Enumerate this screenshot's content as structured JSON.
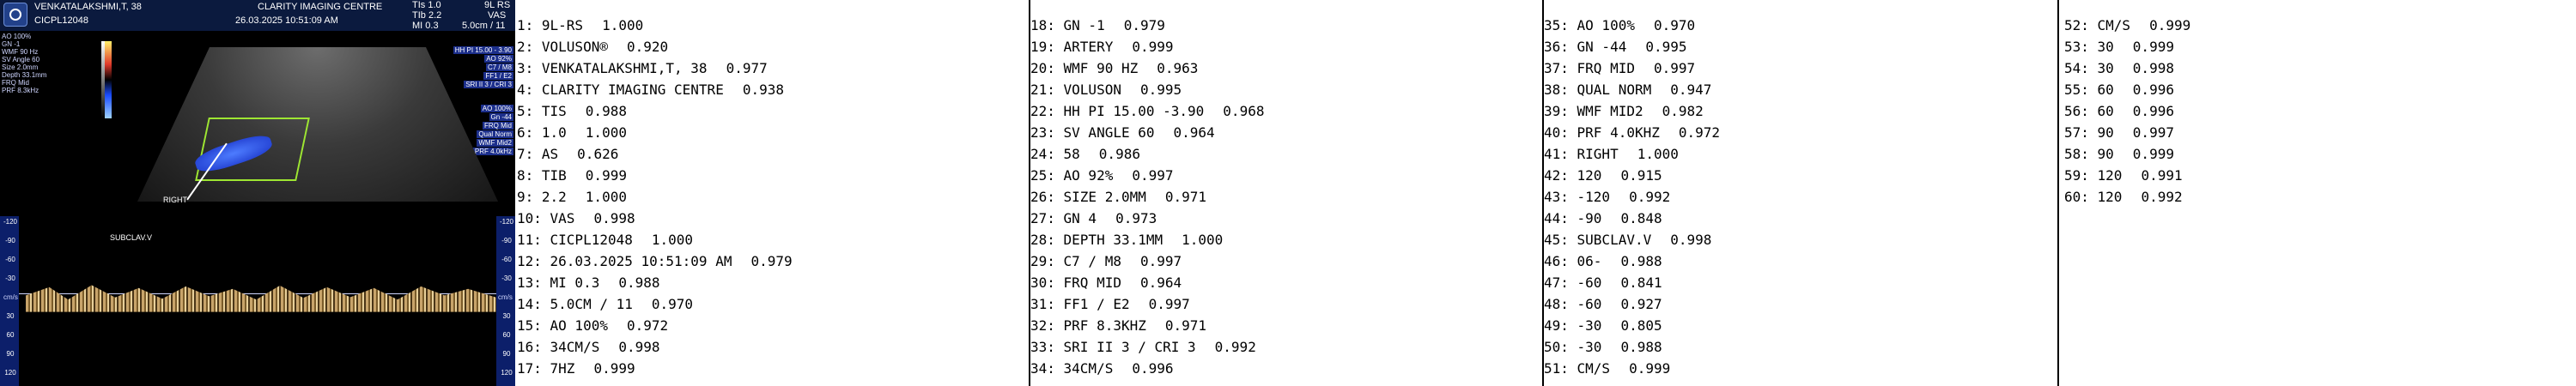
{
  "screenshot": {
    "header": {
      "patient_name": "VENKATALAKSHMI,T,  38",
      "centre": "CLARITY IMAGING CENTRE",
      "patient_id": "CICPL12048",
      "datetime": "26.03.2025  10:51:09 AM",
      "ti": "TIs   1.0",
      "tib": "TIb   2.2",
      "mi": "MI  0.3",
      "depth_field": "5.0cm / 11",
      "probe": "9L RS",
      "preset": "VAS"
    },
    "left_params": [
      "AO 100%",
      "GN -1",
      "WMF 90 Hz",
      "SV Angle 60",
      "Size 2.0mm",
      "Depth 33.1mm",
      "FRQ Mid",
      "PRF 8.3kHz"
    ],
    "right_params": [
      "HH PI 15.00 - 3.90",
      "AO 92%",
      "C7 / M8",
      "FF1 / E2",
      "SRI II 3 / CRI 3"
    ],
    "right_params2": [
      "AO 100%",
      "Gn -44",
      "FRQ Mid",
      "Qual Norm",
      "WMF Mid2",
      "PRF 4.0kHz"
    ],
    "image_labels": {
      "side": "RIGHT",
      "vessel": "SUBCLAV.V",
      "velocity_unit": "cm/s"
    },
    "scale_left": [
      "-120",
      "-90",
      "-60",
      "-30",
      "",
      "30",
      "60",
      "90",
      "120"
    ],
    "scale_right": [
      "-120",
      "-90",
      "-60",
      "-30",
      "",
      "30",
      "60",
      "90",
      "120"
    ]
  },
  "ocr_columns": [
    {
      "lines": [
        {
          "text": "1: 9L-RS",
          "score": "1.000"
        },
        {
          "text": "2: VOLUSON®",
          "score": "0.920"
        },
        {
          "text": "3: VENKATALAKSHMI,T, 38",
          "score": "0.977"
        },
        {
          "text": "4: CLARITY IMAGING CENTRE",
          "score": "0.938"
        },
        {
          "text": "5: TIS",
          "score": "0.988"
        },
        {
          "text": "6: 1.0",
          "score": "1.000"
        },
        {
          "text": "7: AS",
          "score": "0.626"
        },
        {
          "text": "8: TIB",
          "score": "0.999"
        },
        {
          "text": "9: 2.2",
          "score": "1.000"
        },
        {
          "text": "10: VAS",
          "score": "0.998"
        },
        {
          "text": "11: CICPL12048",
          "score": "1.000"
        },
        {
          "text": "12: 26.03.2025 10:51:09 AM",
          "score": "0.979"
        },
        {
          "text": "13: MI 0.3",
          "score": "0.988"
        },
        {
          "text": "14: 5.0CM / 11",
          "score": "0.970"
        },
        {
          "text": "15: AO 100%",
          "score": "0.972"
        },
        {
          "text": "16: 34CM/S",
          "score": "0.998"
        },
        {
          "text": "17: 7HZ",
          "score": "0.999"
        }
      ]
    },
    {
      "lines": [
        {
          "text": "18: GN -1",
          "score": "0.979"
        },
        {
          "text": "19: ARTERY",
          "score": "0.999"
        },
        {
          "text": "20: WMF 90 HZ",
          "score": "0.963"
        },
        {
          "text": "21: VOLUSON",
          "score": "0.995"
        },
        {
          "text": "22: HH PI 15.00 -3.90",
          "score": "0.968"
        },
        {
          "text": "23: SV ANGLE 60",
          "score": "0.964"
        },
        {
          "text": "24: 58",
          "score": "0.986"
        },
        {
          "text": "25: AO 92%",
          "score": "0.997"
        },
        {
          "text": "26: SIZE 2.0MM",
          "score": "0.971"
        },
        {
          "text": "27: GN 4",
          "score": "0.973"
        },
        {
          "text": "28: DEPTH 33.1MM",
          "score": "1.000"
        },
        {
          "text": "29: C7 / M8",
          "score": "0.997"
        },
        {
          "text": "30: FRQ MID",
          "score": "0.964"
        },
        {
          "text": "31: FF1 / E2",
          "score": "0.997"
        },
        {
          "text": "32: PRF 8.3KHZ",
          "score": "0.971"
        },
        {
          "text": "33: SRI II 3 / CRI 3",
          "score": "0.992"
        },
        {
          "text": "34: 34CM/S",
          "score": "0.996"
        }
      ]
    },
    {
      "lines": [
        {
          "text": "35: AO 100%",
          "score": "0.970"
        },
        {
          "text": "36: GN -44",
          "score": "0.995"
        },
        {
          "text": "37: FRQ MID",
          "score": "0.997"
        },
        {
          "text": "38: QUAL NORM",
          "score": "0.947"
        },
        {
          "text": "39: WMF MID2",
          "score": "0.982"
        },
        {
          "text": "40: PRF 4.0KHZ",
          "score": "0.972"
        },
        {
          "text": "41: RIGHT",
          "score": "1.000"
        },
        {
          "text": "42: 120",
          "score": "0.915"
        },
        {
          "text": "43: -120",
          "score": "0.992"
        },
        {
          "text": "44: -90",
          "score": "0.848"
        },
        {
          "text": "45: SUBCLAV.V",
          "score": "0.998"
        },
        {
          "text": "46: 06-",
          "score": "0.988"
        },
        {
          "text": "47: -60",
          "score": "0.841"
        },
        {
          "text": "48: -60",
          "score": "0.927"
        },
        {
          "text": "49: -30",
          "score": "0.805"
        },
        {
          "text": "50: -30",
          "score": "0.988"
        },
        {
          "text": "51: CM/S",
          "score": "0.999"
        }
      ]
    },
    {
      "lines": [
        {
          "text": "52: CM/S",
          "score": "0.999"
        },
        {
          "text": "53: 30",
          "score": "0.999"
        },
        {
          "text": "54: 30",
          "score": "0.998"
        },
        {
          "text": "55: 60",
          "score": "0.996"
        },
        {
          "text": "56: 60",
          "score": "0.996"
        },
        {
          "text": "57: 90",
          "score": "0.997"
        },
        {
          "text": "58: 90",
          "score": "0.999"
        },
        {
          "text": "59: 120",
          "score": "0.991"
        },
        {
          "text": "60: 120",
          "score": "0.992"
        }
      ]
    }
  ]
}
